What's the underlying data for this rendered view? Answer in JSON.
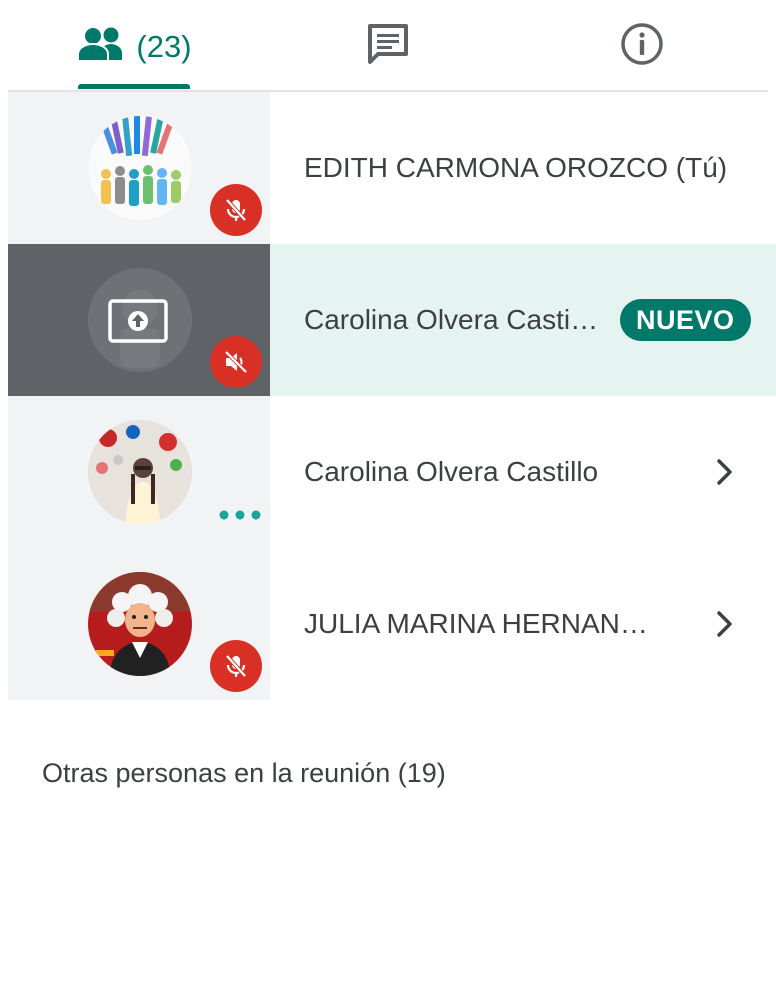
{
  "tabs": {
    "people_count": "(23)",
    "people_icon": "people-icon",
    "chat_icon": "chat-icon",
    "info_icon": "info-icon"
  },
  "colors": {
    "accent": "#00796b",
    "mute_red": "#d93025",
    "row_bg": "#f1f3f4",
    "highlight_bg": "#e6f4f1",
    "presenting_bg": "#5f6368"
  },
  "participants": [
    {
      "name": "EDITH CARMONA OROZCO (Tú)",
      "status_icon": "mic-off-icon",
      "has_chevron": false
    },
    {
      "name": "Carolina Olvera Casti…",
      "status_icon": "volume-off-icon",
      "badge": "NUEVO",
      "presenting": true
    },
    {
      "name": "Carolina Olvera Castillo",
      "status_icon": "speaking-dots-icon",
      "has_chevron": true
    },
    {
      "name": "JULIA MARINA HERNAN…",
      "status_icon": "mic-off-icon",
      "has_chevron": true
    }
  ],
  "others_heading": "Otras personas en la reunión (19)"
}
